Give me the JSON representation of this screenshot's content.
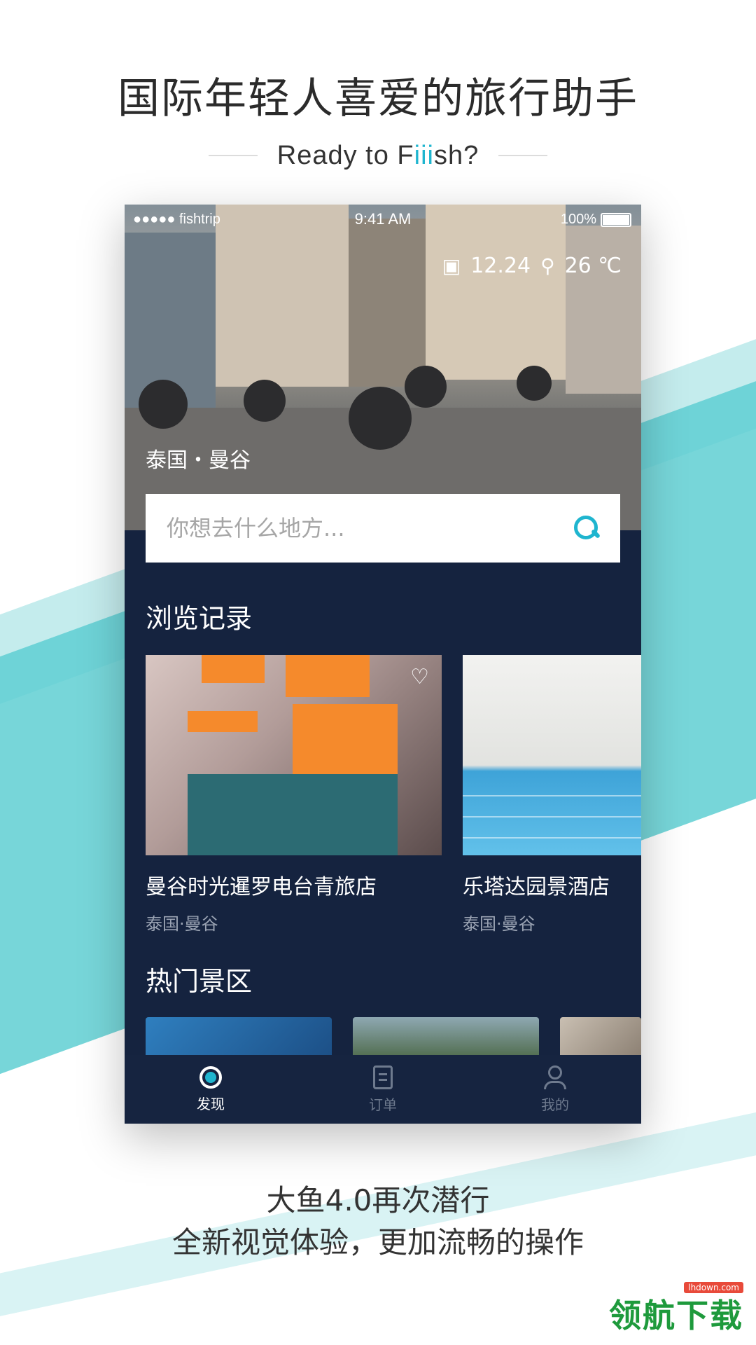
{
  "headline": "国际年轻人喜爱的旅行助手",
  "tagline": {
    "before": "Ready to F",
    "highlight": "iii",
    "after": "sh?"
  },
  "phone": {
    "status_bar": {
      "carrier": "●●●●● fishtrip",
      "time": "9:41 AM",
      "battery": "100%"
    },
    "weather": {
      "date": "12.24",
      "temperature": "26 ℃"
    },
    "location": "泰国・曼谷",
    "search": {
      "placeholder": "你想去什么地方..."
    },
    "history": {
      "title": "浏览记录",
      "items": [
        {
          "name": "曼谷时光暹罗电台青旅店",
          "place": "泰国·曼谷"
        },
        {
          "name": "乐塔达园景酒店",
          "place": "泰国·曼谷"
        }
      ]
    },
    "hot": {
      "title": "热门景区"
    },
    "tabs": [
      {
        "label": "发现",
        "active": true
      },
      {
        "label": "订单",
        "active": false
      },
      {
        "label": "我的",
        "active": false
      }
    ]
  },
  "bottom": {
    "line1": "大鱼4.0再次潜行",
    "line2": "全新视觉体验，更加流畅的操作"
  },
  "watermark": {
    "site": "lhdown.com",
    "text": "领航下载"
  },
  "colors": {
    "accent": "#1fb5cf",
    "app_bg": "#15233f",
    "stripe": "#5fcfd2"
  }
}
